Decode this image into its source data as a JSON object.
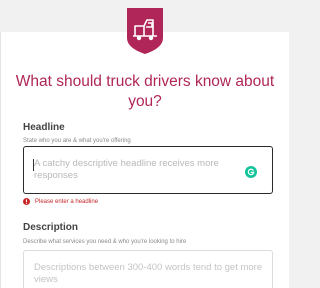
{
  "form": {
    "title": "What should truck drivers know about you?",
    "headline": {
      "label": "Headline",
      "hint": "State who you are & what you're offering",
      "placeholder": "A catchy descriptive headline receives more responses",
      "error": "Please enter a headline"
    },
    "description": {
      "label": "Description",
      "hint": "Describe what services you need & who you're looking to hire",
      "placeholder": "Descriptions between 300-400 words tend to get more views"
    }
  },
  "icons": {
    "logo": "truck-badge-icon",
    "grammarly": "grammarly-icon",
    "error": "error-icon"
  },
  "colors": {
    "brand": "#b02658",
    "error": "#c62828",
    "grammarly": "#15c39a",
    "focus_border": "#2b2b2b"
  }
}
